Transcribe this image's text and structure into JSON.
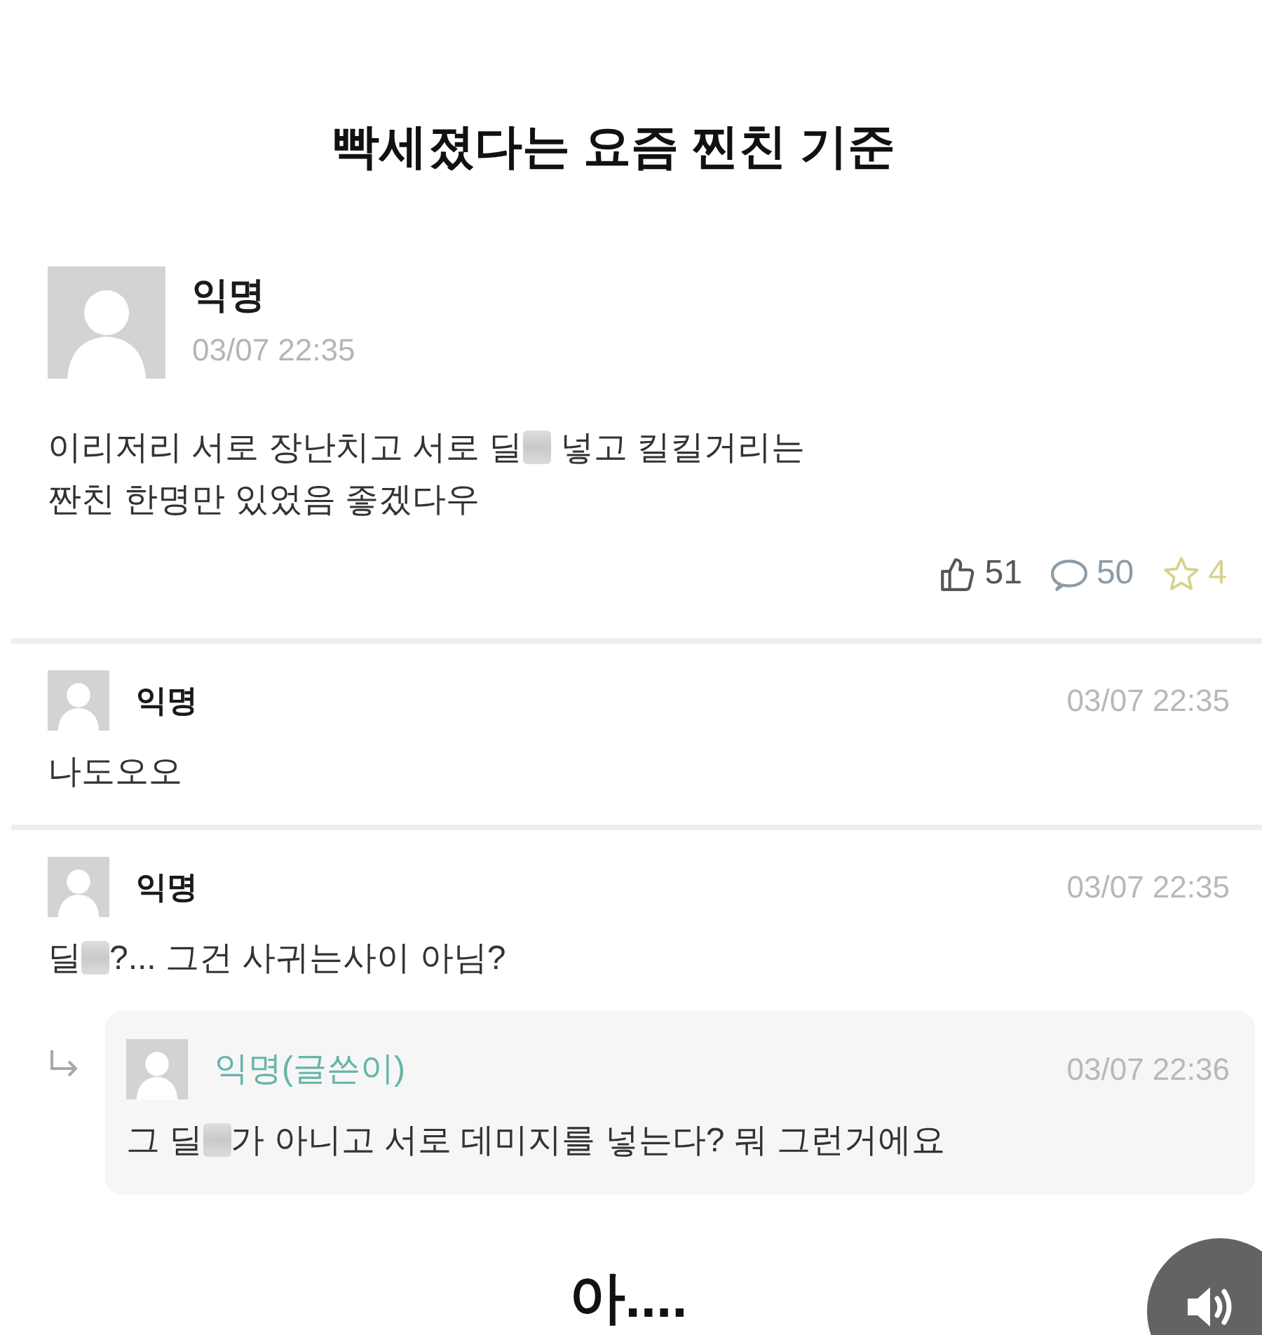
{
  "title": "빡세졌다는 요즘 찐친 기준",
  "post": {
    "author": "익명",
    "date": "03/07 22:35",
    "body_lines": [
      [
        {
          "kind": "text",
          "text": "이리저리 서로 장난치고 서로 딜"
        },
        {
          "kind": "blur"
        },
        {
          "kind": "text",
          "text": " 넣고 킬킬거리는"
        }
      ],
      [
        {
          "kind": "text",
          "text": "짠친 한명만 있었음 좋겠다우"
        }
      ]
    ],
    "stats": [
      {
        "kind": "like",
        "count": "51",
        "color": "#555555"
      },
      {
        "kind": "comment",
        "count": "50",
        "color": "#8c9ba6"
      },
      {
        "kind": "star",
        "count": "4",
        "color": "#d6d28e"
      }
    ]
  },
  "comments": [
    {
      "author": "익명",
      "is_writer": false,
      "date": "03/07 22:35",
      "body": [
        {
          "kind": "text",
          "text": "나도오오"
        }
      ]
    },
    {
      "author": "익명",
      "is_writer": false,
      "date": "03/07 22:35",
      "body": [
        {
          "kind": "text",
          "text": "딜"
        },
        {
          "kind": "blur"
        },
        {
          "kind": "text",
          "text": "?... 그건 사귀는사이 아님?"
        }
      ],
      "children": [
        {
          "author": "익명(글쓴이)",
          "is_writer": true,
          "date": "03/07 22:36",
          "body": [
            {
              "kind": "text",
              "text": "그 딜"
            },
            {
              "kind": "blur"
            },
            {
              "kind": "text",
              "text": "가 아니고 서로 데미지를 넣는다? 뭐 그런거에요"
            }
          ]
        }
      ]
    }
  ],
  "caption": "아...."
}
